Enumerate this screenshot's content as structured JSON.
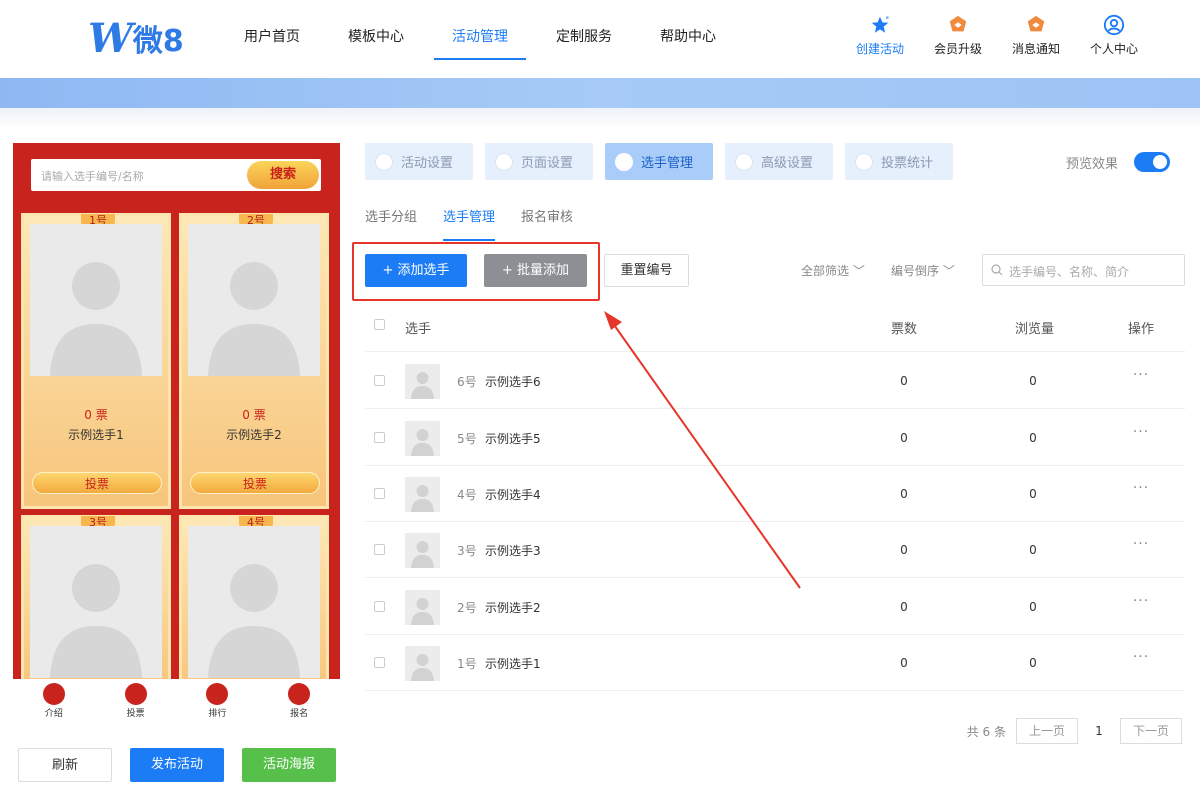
{
  "brand": {
    "logo_mark": "W",
    "logo_text": "微8",
    "color": "#2f7be6"
  },
  "nav": {
    "items": [
      "用户首页",
      "模板中心",
      "活动管理",
      "定制服务",
      "帮助中心"
    ],
    "active": "活动管理",
    "actions": [
      {
        "label": "创建活动",
        "icon": "star-icon"
      },
      {
        "label": "会员升级",
        "icon": "crown-badge-icon"
      },
      {
        "label": "消息通知",
        "icon": "bell-badge-icon"
      },
      {
        "label": "个人中心",
        "icon": "user-icon"
      }
    ]
  },
  "preview": {
    "search_placeholder": "请输入选手编号/名称",
    "search_button": "搜索",
    "cards": [
      {
        "num": "1号",
        "votes": "0 票",
        "name": "示例选手1",
        "vote_button": "投票"
      },
      {
        "num": "2号",
        "votes": "0 票",
        "name": "示例选手2",
        "vote_button": "投票"
      },
      {
        "num": "3号"
      },
      {
        "num": "4号"
      }
    ],
    "tabs": [
      "介绍",
      "投票",
      "排行",
      "报名"
    ],
    "buttons": {
      "refresh": "刷新",
      "publish": "发布活动",
      "poster": "活动海报"
    }
  },
  "steps": [
    "活动设置",
    "页面设置",
    "选手管理",
    "高级设置",
    "投票统计"
  ],
  "active_step": "选手管理",
  "preview_toggle": {
    "label": "预览效果",
    "on": true
  },
  "subtabs": [
    "选手分组",
    "选手管理",
    "报名审核"
  ],
  "active_subtab": "选手管理",
  "toolbar": {
    "add": "+ 添加选手",
    "batch": "+ 批量添加",
    "reset": "重置编号",
    "filter_all": "全部筛选",
    "sort": "编号倒序",
    "search_placeholder": "选手编号、名称、简介"
  },
  "table": {
    "headers": {
      "player": "选手",
      "votes": "票数",
      "views": "浏览量",
      "ops": "操作"
    },
    "rows": [
      {
        "no": "6号",
        "name": "示例选手6",
        "votes": "0",
        "views": "0"
      },
      {
        "no": "5号",
        "name": "示例选手5",
        "votes": "0",
        "views": "0"
      },
      {
        "no": "4号",
        "name": "示例选手4",
        "votes": "0",
        "views": "0"
      },
      {
        "no": "3号",
        "name": "示例选手3",
        "votes": "0",
        "views": "0"
      },
      {
        "no": "2号",
        "name": "示例选手2",
        "votes": "0",
        "views": "0"
      },
      {
        "no": "1号",
        "name": "示例选手1",
        "votes": "0",
        "views": "0"
      }
    ],
    "more": "···"
  },
  "pager": {
    "total": "共 6 条",
    "prev": "上一页",
    "current": "1",
    "next": "下一页"
  },
  "colors": {
    "primary": "#1b7cf5",
    "phone_bg": "#c8231c",
    "highlight": "#e6362b",
    "poster": "#57c04a"
  }
}
